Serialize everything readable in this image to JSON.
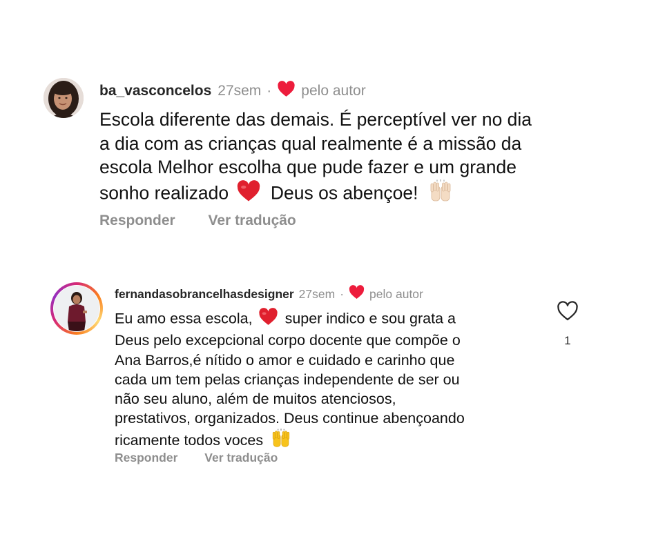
{
  "comments": [
    {
      "username": "ba_vasconcelos",
      "time": "27sem",
      "separator": "·",
      "liked_by_author": "pelo autor",
      "lines": [
        "Escola diferente das demais. É perceptível ver no dia",
        "a dia com as crianças qual realmente é a missão da",
        "escola  Melhor escolha que pude fazer e um grande",
        "sonho realizado"
      ],
      "line4_tail": "Deus os abençoe!",
      "emojis": [
        "red-heart",
        "raising-hands-light-skin"
      ],
      "reply_label": "Responder",
      "translate_label": "Ver tradução"
    },
    {
      "username": "fernandasobrancelhasdesigner",
      "time": "27sem",
      "separator": "·",
      "liked_by_author": "pelo autor",
      "line1_head": "Eu amo essa escola,",
      "line1_tail": "super indico e sou grata a",
      "lines": [
        "Deus pelo excepcional corpo docente que compõe o",
        "Ana Barros,é nítido o amor e cuidado e carinho que",
        "cada um tem pelas crianças independente de ser ou",
        "não seu aluno, além de muitos atenciosos,",
        "prestativos, organizados. Deus continue abençoando"
      ],
      "last_line": "ricamente todos voces",
      "emojis": [
        "red-heart",
        "raising-hands"
      ],
      "reply_label": "Responder",
      "translate_label": "Ver tradução",
      "like_count": "1"
    }
  ],
  "colors": {
    "heart_red": "#ed1c3c",
    "secondary_text": "#8e8e8e",
    "primary_text": "#111111"
  }
}
